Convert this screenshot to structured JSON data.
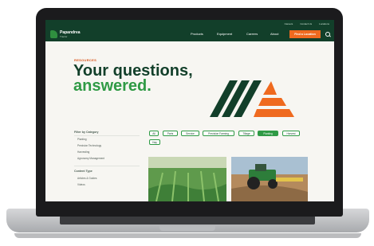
{
  "header": {
    "utility_links": [
      "Careers",
      "Contact Us",
      "Locations"
    ],
    "brand_name": "Papandrea",
    "brand_tagline": "Tractor",
    "nav": [
      "Products",
      "Equipment",
      "Careers",
      "About"
    ],
    "cta": "Find a Location"
  },
  "hero": {
    "eyebrow": "RESOURCES",
    "title_line1": "Your questions,",
    "title_line2": "answered."
  },
  "sidebar": {
    "group1_title": "Filter by Category",
    "group1_items": [
      "Planting",
      "Precision Technology",
      "Harvesting",
      "Agronomy Management"
    ],
    "group2_title": "Content Type",
    "group2_items": [
      "Articles & Guides",
      "Videos"
    ]
  },
  "filters": {
    "pills": [
      "All",
      "Parts",
      "Service",
      "Precision Farming",
      "Tillage",
      "Planting",
      "Harvest",
      "Hay"
    ],
    "active_pill": "Planting"
  },
  "colors": {
    "brand_dark_green": "#123f2a",
    "brand_green": "#2f9a45",
    "accent_orange": "#ef6a1f"
  },
  "icons": {
    "search": "search-icon",
    "logo": "logo-icon"
  }
}
